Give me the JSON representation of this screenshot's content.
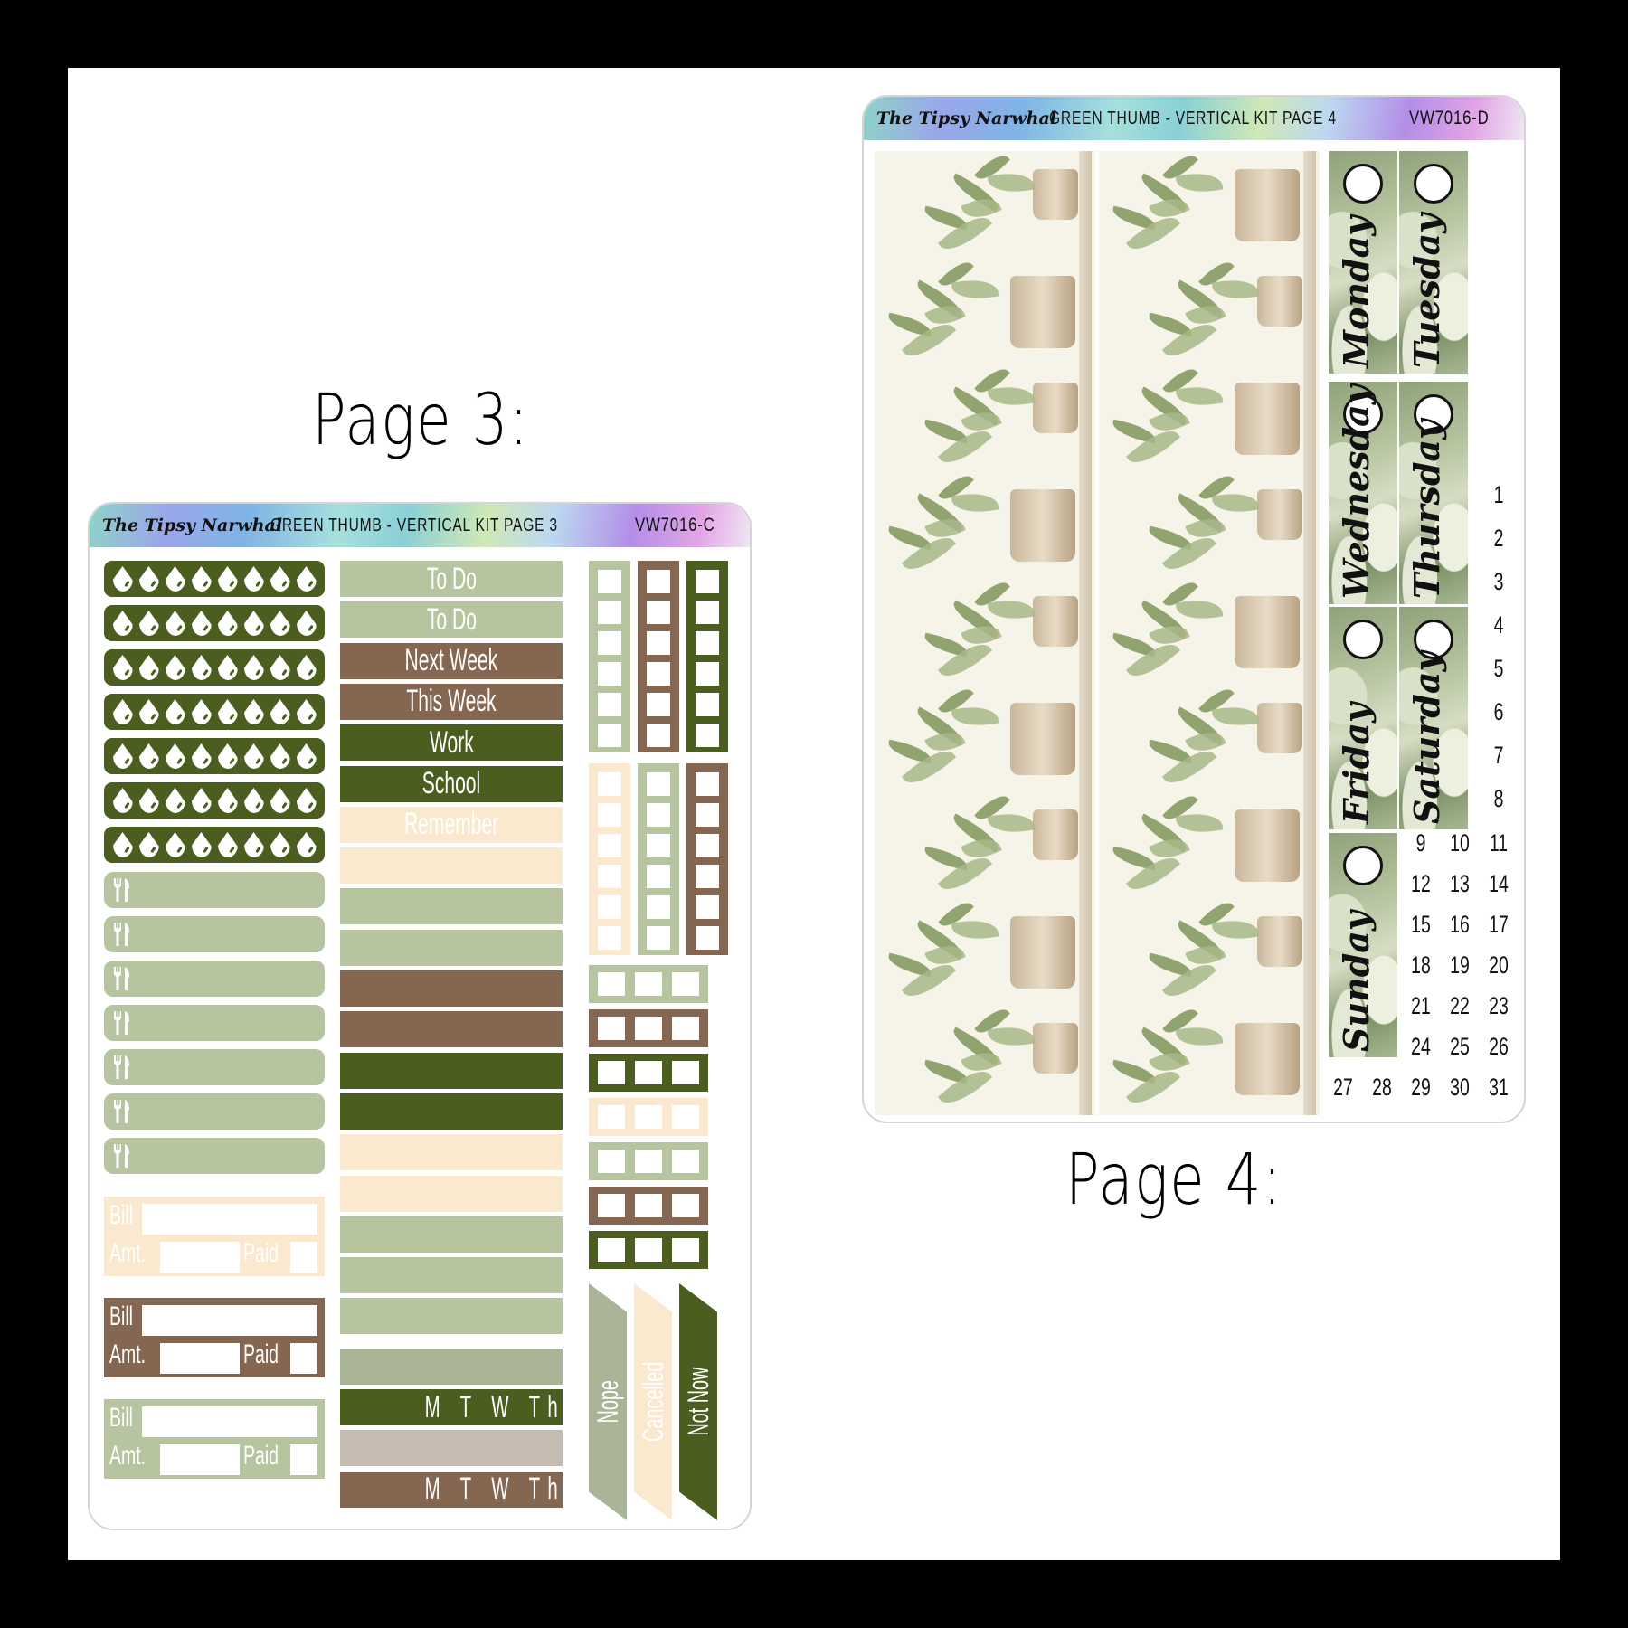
{
  "labels": {
    "page3": "Page 3:",
    "page4": "Page 4:"
  },
  "colors": {
    "dark_green": "#4b5e1f",
    "sage": "#b7c4a0",
    "brown": "#856751",
    "cream": "#fbe9cf",
    "taupe": "#c6bbb1",
    "grey_sage": "#a9b496"
  },
  "page3": {
    "brand": "The Tipsy Narwhal",
    "title": "GREEN THUMB - VERTICAL KIT PAGE 3",
    "code": "VW7016-C",
    "water_trackers": {
      "rows": 7,
      "drops_per_row": 8,
      "icon": "water-drop-icon"
    },
    "meal_trackers": {
      "rows": 7,
      "icon": "fork-knife-icon"
    },
    "bill_trackers": [
      {
        "color": "cream",
        "bill": "Bill",
        "amt": "Amt.",
        "paid": "Paid"
      },
      {
        "color": "brown",
        "bill": "Bill",
        "amt": "Amt.",
        "paid": "Paid"
      },
      {
        "color": "sage",
        "bill": "Bill",
        "amt": "Amt.",
        "paid": "Paid"
      }
    ],
    "strips": [
      {
        "color": "sage",
        "text": "To Do"
      },
      {
        "color": "sage",
        "text": "To Do"
      },
      {
        "color": "brown",
        "text": "Next Week"
      },
      {
        "color": "brown",
        "text": "This Week"
      },
      {
        "color": "dark_green",
        "text": "Work"
      },
      {
        "color": "dark_green",
        "text": "School"
      },
      {
        "color": "cream",
        "text": "Remember"
      },
      {
        "color": "cream",
        "text": ""
      },
      {
        "color": "sage",
        "text": ""
      },
      {
        "color": "sage",
        "text": ""
      },
      {
        "color": "brown",
        "text": ""
      },
      {
        "color": "brown",
        "text": ""
      },
      {
        "color": "dark_green",
        "text": ""
      },
      {
        "color": "dark_green",
        "text": ""
      },
      {
        "color": "cream",
        "text": ""
      },
      {
        "color": "cream",
        "text": ""
      },
      {
        "color": "sage",
        "text": ""
      },
      {
        "color": "sage",
        "text": ""
      },
      {
        "color": "sage",
        "text": ""
      },
      {
        "color": "grey_sage",
        "text": ""
      },
      {
        "color": "dark_green",
        "text": "M T W Th F S S"
      },
      {
        "color": "taupe",
        "text": ""
      },
      {
        "color": "brown",
        "text": "M T W Th F S S"
      }
    ],
    "vertical_checkboxes": [
      {
        "color": "sage",
        "boxes": 6
      },
      {
        "color": "brown",
        "boxes": 6
      },
      {
        "color": "dark_green",
        "boxes": 6
      },
      {
        "color": "cream",
        "boxes": 6
      },
      {
        "color": "sage",
        "boxes": 6
      },
      {
        "color": "brown",
        "boxes": 6
      }
    ],
    "horizontal_checkboxes": [
      {
        "color": "sage",
        "boxes": 3
      },
      {
        "color": "brown",
        "boxes": 3
      },
      {
        "color": "dark_green",
        "boxes": 3
      },
      {
        "color": "cream",
        "boxes": 3
      },
      {
        "color": "sage",
        "boxes": 3
      },
      {
        "color": "brown",
        "boxes": 3
      },
      {
        "color": "dark_green",
        "boxes": 3
      }
    ],
    "flags": [
      {
        "color": "grey_sage",
        "text": "Nope"
      },
      {
        "color": "cream",
        "text": "Cancelled"
      },
      {
        "color": "dark_green",
        "text": "Not Now"
      }
    ]
  },
  "page4": {
    "brand": "The Tipsy Narwhal",
    "title": "GREEN THUMB - VERTICAL KIT PAGE 4",
    "code": "VW7016-D",
    "decorative_strips": [
      "potted-herbs-illustration",
      "potted-herbs-illustration"
    ],
    "days": [
      "Monday",
      "Tuesday",
      "Wednesday",
      "Thursday",
      "Friday",
      "Saturday",
      "Sunday"
    ],
    "date_numbers": [
      "1",
      "2",
      "3",
      "4",
      "5",
      "6",
      "7",
      "8",
      "9",
      "10",
      "11",
      "12",
      "13",
      "14",
      "15",
      "16",
      "17",
      "18",
      "19",
      "20",
      "21",
      "22",
      "23",
      "24",
      "25",
      "26",
      "27",
      "28",
      "29",
      "30",
      "31"
    ]
  }
}
